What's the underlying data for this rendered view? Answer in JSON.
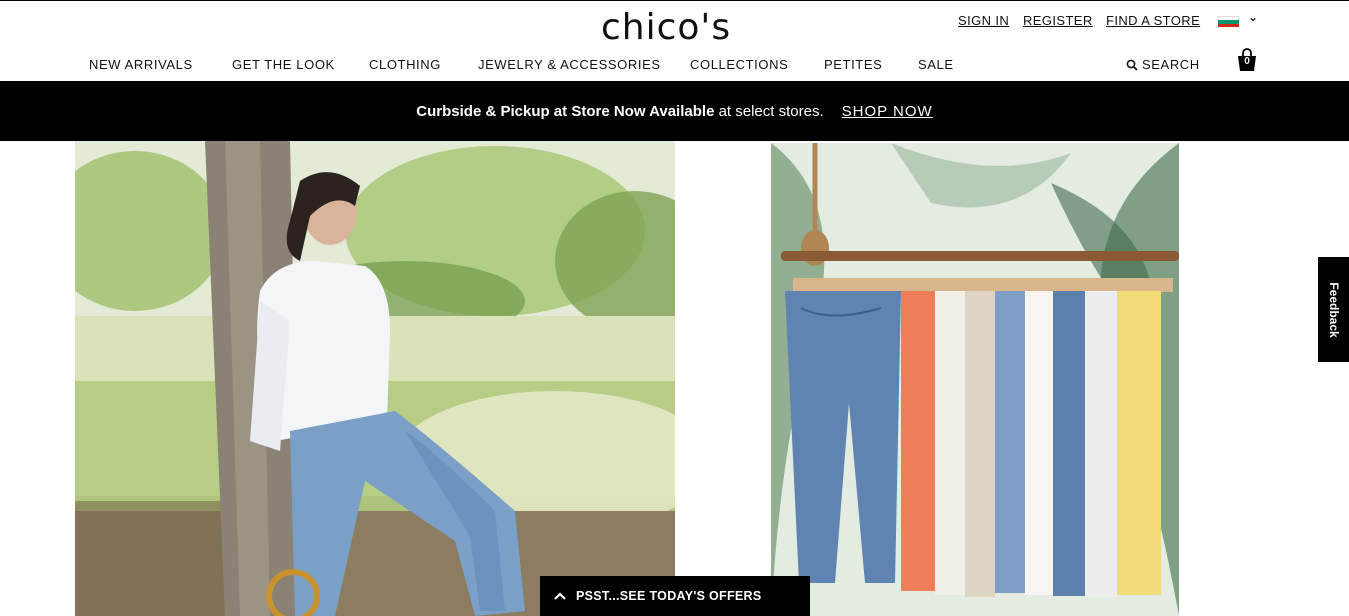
{
  "header": {
    "logo": "chico's",
    "utility_links": [
      "SIGN IN",
      "REGISTER",
      "FIND A STORE"
    ],
    "country_flag": {
      "icon": "bulgaria-flag-icon",
      "colors": [
        "#ffffff",
        "#00966e",
        "#d62612"
      ]
    },
    "nav": [
      "NEW ARRIVALS",
      "GET THE LOOK",
      "CLOTHING",
      "JEWELRY & ACCESSORIES",
      "COLLECTIONS",
      "PETITES",
      "SALE"
    ],
    "search_label": "SEARCH",
    "cart_count": "0"
  },
  "promo": {
    "bold_text": "Curbside & Pickup at Store Now Available",
    "rest_text": " at select stores.",
    "cta": "SHOP NOW"
  },
  "feedback_label": "Feedback",
  "offers_label": "PSST...SEE TODAY'S OFFERS",
  "colors": {
    "accent": "#000000",
    "background": "#ffffff"
  }
}
